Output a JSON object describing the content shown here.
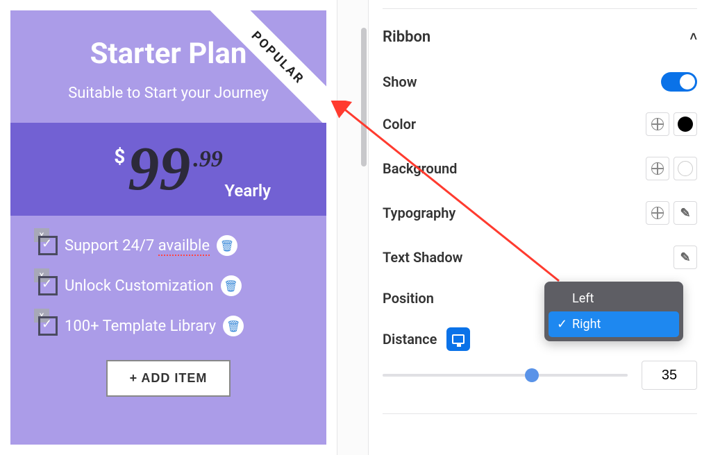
{
  "preview": {
    "plan_title": "Starter Plan",
    "plan_subtitle": "Suitable to Start your Journey",
    "ribbon_text": "POPULAR",
    "currency": "$",
    "price_main": "99",
    "price_dec": ".99",
    "period": "Yearly",
    "features": [
      {
        "label_pre": "Support 24/7 ",
        "label_err": "availble"
      },
      {
        "label_pre": "Unlock Customization",
        "label_err": ""
      },
      {
        "label_pre": "100+ Template Library",
        "label_err": ""
      }
    ],
    "close_badge": "x",
    "add_item_label": "+ ADD ITEM"
  },
  "panel": {
    "section_title": "Ribbon",
    "rows": {
      "show": "Show",
      "color": "Color",
      "background": "Background",
      "typography": "Typography",
      "text_shadow": "Text Shadow",
      "position": "Position",
      "distance": "Distance"
    },
    "position_options": {
      "left": "Left",
      "right": "Right"
    },
    "distance_value": "35"
  },
  "colors": {
    "accent": "#0a72e8",
    "card_bg": "#ab9ce8",
    "price_bg": "#7261d3"
  }
}
